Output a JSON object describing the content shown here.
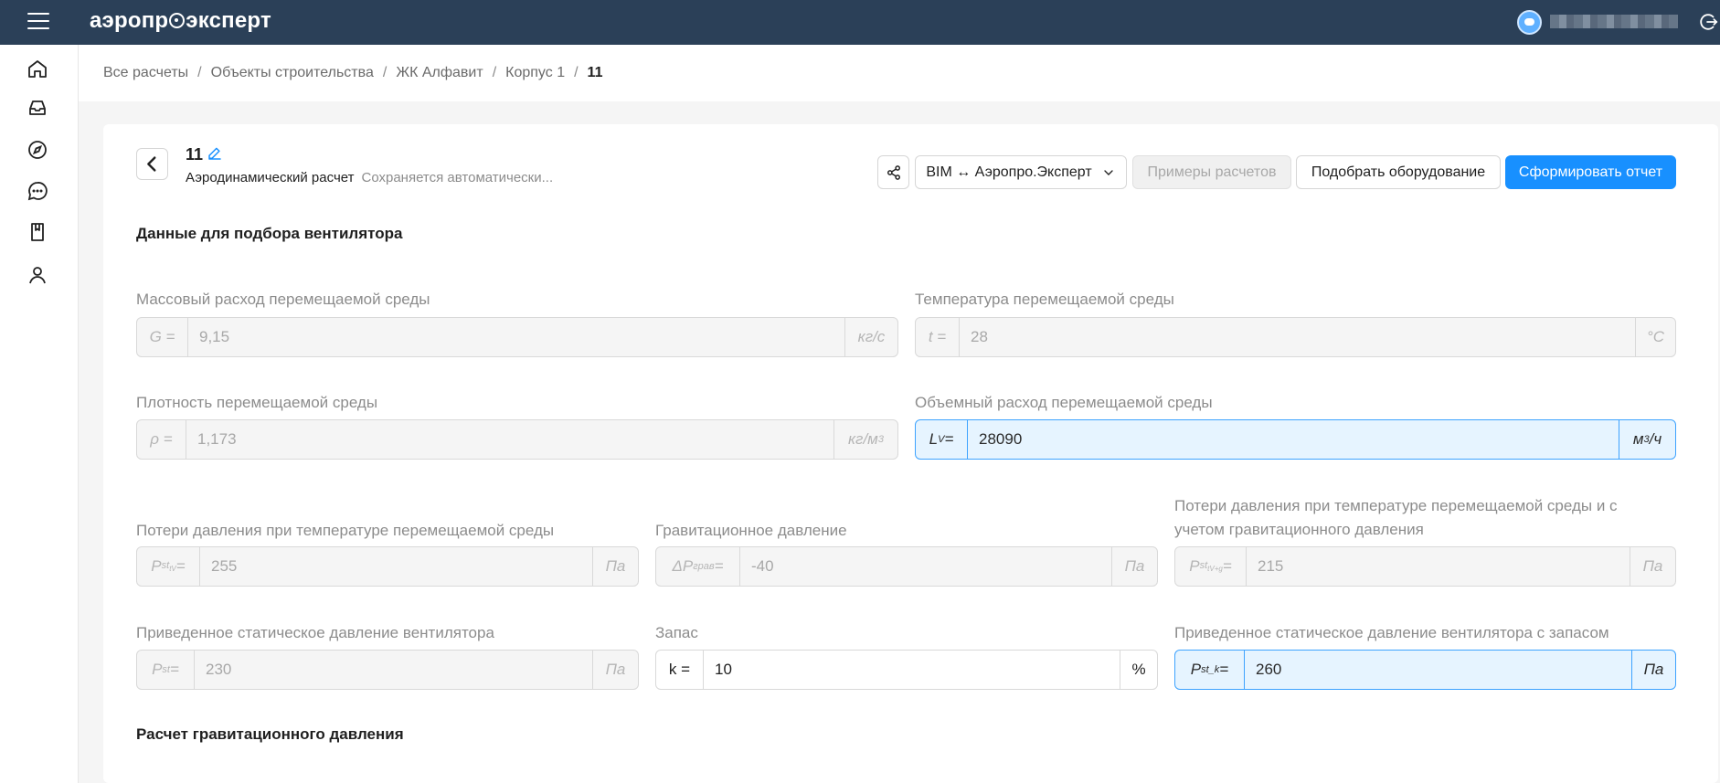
{
  "topbar": {
    "logo_before": "аэропр",
    "logo_after": "эксперт"
  },
  "breadcrumb": {
    "items": [
      "Все расчеты",
      "Объекты строительства",
      "ЖК Алфавит",
      "Корпус 1"
    ],
    "separator": "/",
    "current": "11"
  },
  "header": {
    "title": "11",
    "subtitle": "Аэродинамический расчет",
    "autosave": "Сохраняется автоматически..."
  },
  "toolbar": {
    "bim_label": "BIM ↔ Аэропро.Эксперт",
    "examples_label": "Примеры расчетов",
    "equipment_label": "Подобрать оборудование",
    "report_label": "Сформировать отчет"
  },
  "sections": {
    "fan_data": "Данные для подбора вентилятора",
    "grav_calc": "Расчет гравитационного давления"
  },
  "fields": {
    "mass_flow": {
      "label": "Массовый расход перемещаемой среды",
      "prefix": "G =",
      "value": "9,15",
      "unit": "кг/с"
    },
    "temperature": {
      "label": "Температура перемещаемой среды",
      "prefix": "t =",
      "value": "28",
      "unit": "°C"
    },
    "density": {
      "label": "Плотность перемещаемой среды",
      "prefix": "ρ =",
      "value": "1,173",
      "unit_base": "кг/м",
      "unit_sup": "3"
    },
    "volume_flow": {
      "label": "Объемный расход перемещаемой среды",
      "prefix_base": "L",
      "prefix_sub": "V",
      "prefix_eq": " =",
      "value": "28090",
      "unit_base": "м",
      "unit_sup": "3",
      "unit_tail": "/ч"
    },
    "pressure_loss": {
      "label": "Потери давления при температуре перемещаемой среды",
      "prefix_base": "P",
      "prefix_sub": "st",
      "prefix_subsub": "tV",
      "prefix_eq": "=",
      "value": "255",
      "unit": "Па"
    },
    "grav_pressure": {
      "label": "Гравитационное давление",
      "prefix_base": "ΔP",
      "prefix_sub": "грав",
      "prefix_eq": " =",
      "value": "-40",
      "unit": "Па"
    },
    "pressure_loss_grav": {
      "label": "Потери давления при температуре перемещаемой среды и с учетом гравитационного давления",
      "prefix_base": "P",
      "prefix_sub": "st",
      "prefix_subsub": "tV+g",
      "prefix_eq": "=",
      "value": "215",
      "unit": "Па"
    },
    "reduced_static": {
      "label": "Приведенное статическое давление вентилятора",
      "prefix_base": "P",
      "prefix_sub": "st",
      "prefix_eq": " =",
      "value": "230",
      "unit": "Па"
    },
    "margin": {
      "label": "Запас",
      "prefix": "k =",
      "value": "10",
      "unit": "%"
    },
    "reduced_static_margin": {
      "label": "Приведенное статическое давление вентилятора с запасом",
      "prefix_base": "P",
      "prefix_sub": "st_k",
      "prefix_eq": " =",
      "value": "260",
      "unit": "Па"
    }
  },
  "colors": {
    "topbar": "#2b4058",
    "primary": "#1890ff",
    "highlight_bg": "#e6f4ff",
    "highlight_border": "#3ea3ff"
  }
}
